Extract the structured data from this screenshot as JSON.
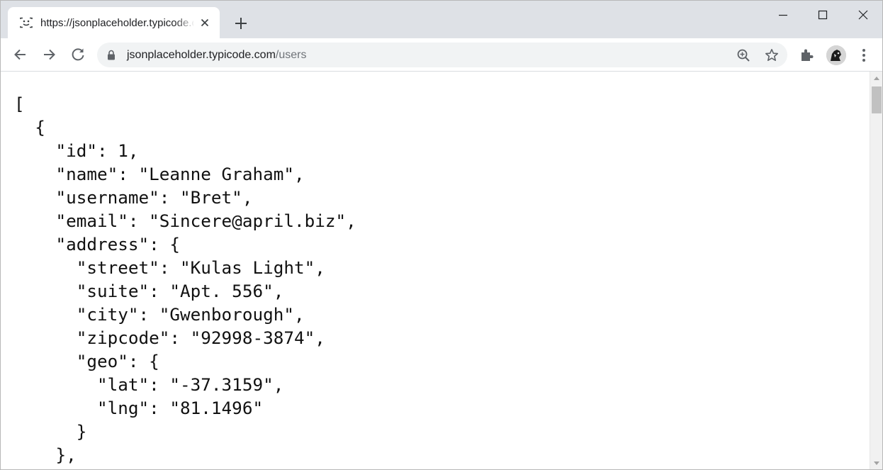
{
  "browser": {
    "tab": {
      "title": "https://jsonplaceholder.typicode.com/users",
      "favicon": "braces-favicon-icon"
    },
    "address_bar": {
      "host": "jsonplaceholder.typicode.com",
      "path": "/users"
    },
    "icons": [
      "back-icon",
      "forward-icon",
      "reload-icon",
      "lock-icon",
      "zoom-icon",
      "star-icon",
      "extensions-icon",
      "menu-icon",
      "new-tab-icon",
      "close-icon",
      "minimize-icon",
      "maximize-icon"
    ],
    "colors": {
      "tabstrip": "#dee1e6",
      "omnibox": "#f1f3f4",
      "url_path": "#6f7378"
    }
  },
  "page": {
    "json_lines": [
      "[",
      "  {",
      "    \"id\": 1,",
      "    \"name\": \"Leanne Graham\",",
      "    \"username\": \"Bret\",",
      "    \"email\": \"Sincere@april.biz\",",
      "    \"address\": {",
      "      \"street\": \"Kulas Light\",",
      "      \"suite\": \"Apt. 556\",",
      "      \"city\": \"Gwenborough\",",
      "      \"zipcode\": \"92998-3874\",",
      "      \"geo\": {",
      "        \"lat\": \"-37.3159\",",
      "        \"lng\": \"81.1496\"",
      "      }",
      "    },"
    ]
  }
}
